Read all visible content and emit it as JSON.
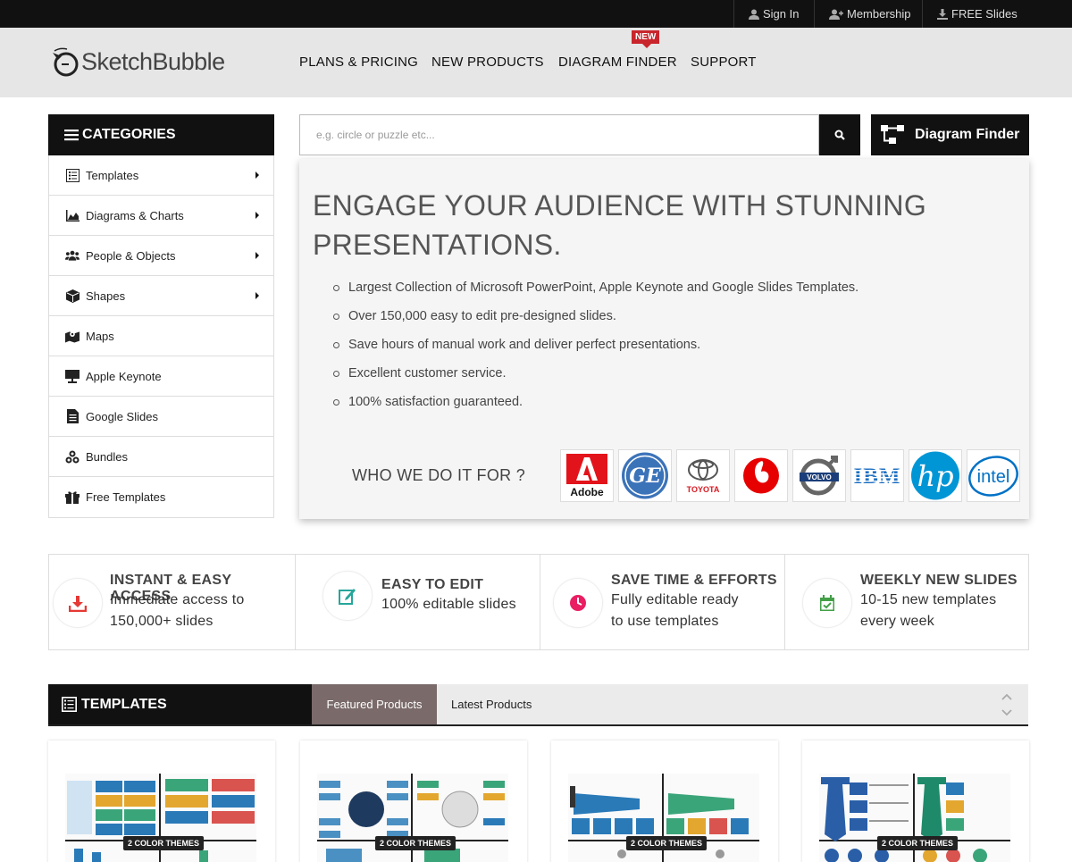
{
  "topbar": {
    "sign_in": "Sign In",
    "membership": "Membership",
    "free_slides": "FREE Slides"
  },
  "header": {
    "logo_text": "SketchBubble",
    "nav": [
      "PLANS & PRICING",
      "NEW PRODUCTS",
      "DIAGRAM FINDER",
      "SUPPORT"
    ],
    "new_badge": "NEW"
  },
  "categories": {
    "title": "CATEGORIES",
    "items": [
      {
        "label": "Templates",
        "icon": "templates-icon",
        "has_submenu": true
      },
      {
        "label": "Diagrams & Charts",
        "icon": "chart-icon",
        "has_submenu": true
      },
      {
        "label": "People & Objects",
        "icon": "people-icon",
        "has_submenu": true
      },
      {
        "label": "Shapes",
        "icon": "cube-icon",
        "has_submenu": true
      },
      {
        "label": "Maps",
        "icon": "map-icon",
        "has_submenu": false
      },
      {
        "label": "Apple Keynote",
        "icon": "keynote-icon",
        "has_submenu": false
      },
      {
        "label": "Google Slides",
        "icon": "document-icon",
        "has_submenu": false
      },
      {
        "label": "Bundles",
        "icon": "bundles-icon",
        "has_submenu": false
      },
      {
        "label": "Free Templates",
        "icon": "gift-icon",
        "has_submenu": false
      }
    ]
  },
  "search": {
    "placeholder": "e.g. circle or puzzle etc..."
  },
  "diagram_finder_label": "Diagram Finder",
  "hero": {
    "title": "ENGAGE YOUR AUDIENCE WITH STUNNING PRESENTATIONS.",
    "bullets": [
      "Largest Collection of Microsoft PowerPoint, Apple Keynote and Google Slides Templates.",
      "Over 150,000 easy to edit pre-designed slides.",
      "Save hours of manual work and deliver perfect presentations.",
      "Excellent customer service.",
      "100% satisfaction guaranteed."
    ],
    "who_label": "WHO WE DO IT FOR ?",
    "brands": [
      "Adobe",
      "GE",
      "TOYOTA",
      "Vodafone",
      "VOLVO",
      "IBM",
      "hp",
      "intel"
    ]
  },
  "features": [
    {
      "title": "INSTANT & EASY ACCESS",
      "desc1": "Immediate access to",
      "desc2": "150,000+ slides",
      "icon": "download-icon",
      "color": "#e53935"
    },
    {
      "title": "EASY TO EDIT",
      "desc1": "100% editable slides",
      "desc2": "",
      "icon": "edit-icon",
      "color": "#26a69a"
    },
    {
      "title": "SAVE TIME & EFFORTS",
      "desc1": "Fully editable ready",
      "desc2": "to use templates",
      "icon": "clock-icon",
      "color": "#e91e63"
    },
    {
      "title": "WEEKLY NEW SLIDES",
      "desc1": "10-15 new templates",
      "desc2": "every week",
      "icon": "calendar-check-icon",
      "color": "#43a047"
    }
  ],
  "templates": {
    "title": "TEMPLATES",
    "tab_featured": "Featured Products",
    "tab_latest": "Latest Products",
    "card_badge": "2 COLOR THEMES"
  },
  "colors": {
    "dark": "#111111",
    "header_bg": "#e6e6e6",
    "tab_active": "#7a6a6a",
    "badge_red": "#c9252c"
  }
}
